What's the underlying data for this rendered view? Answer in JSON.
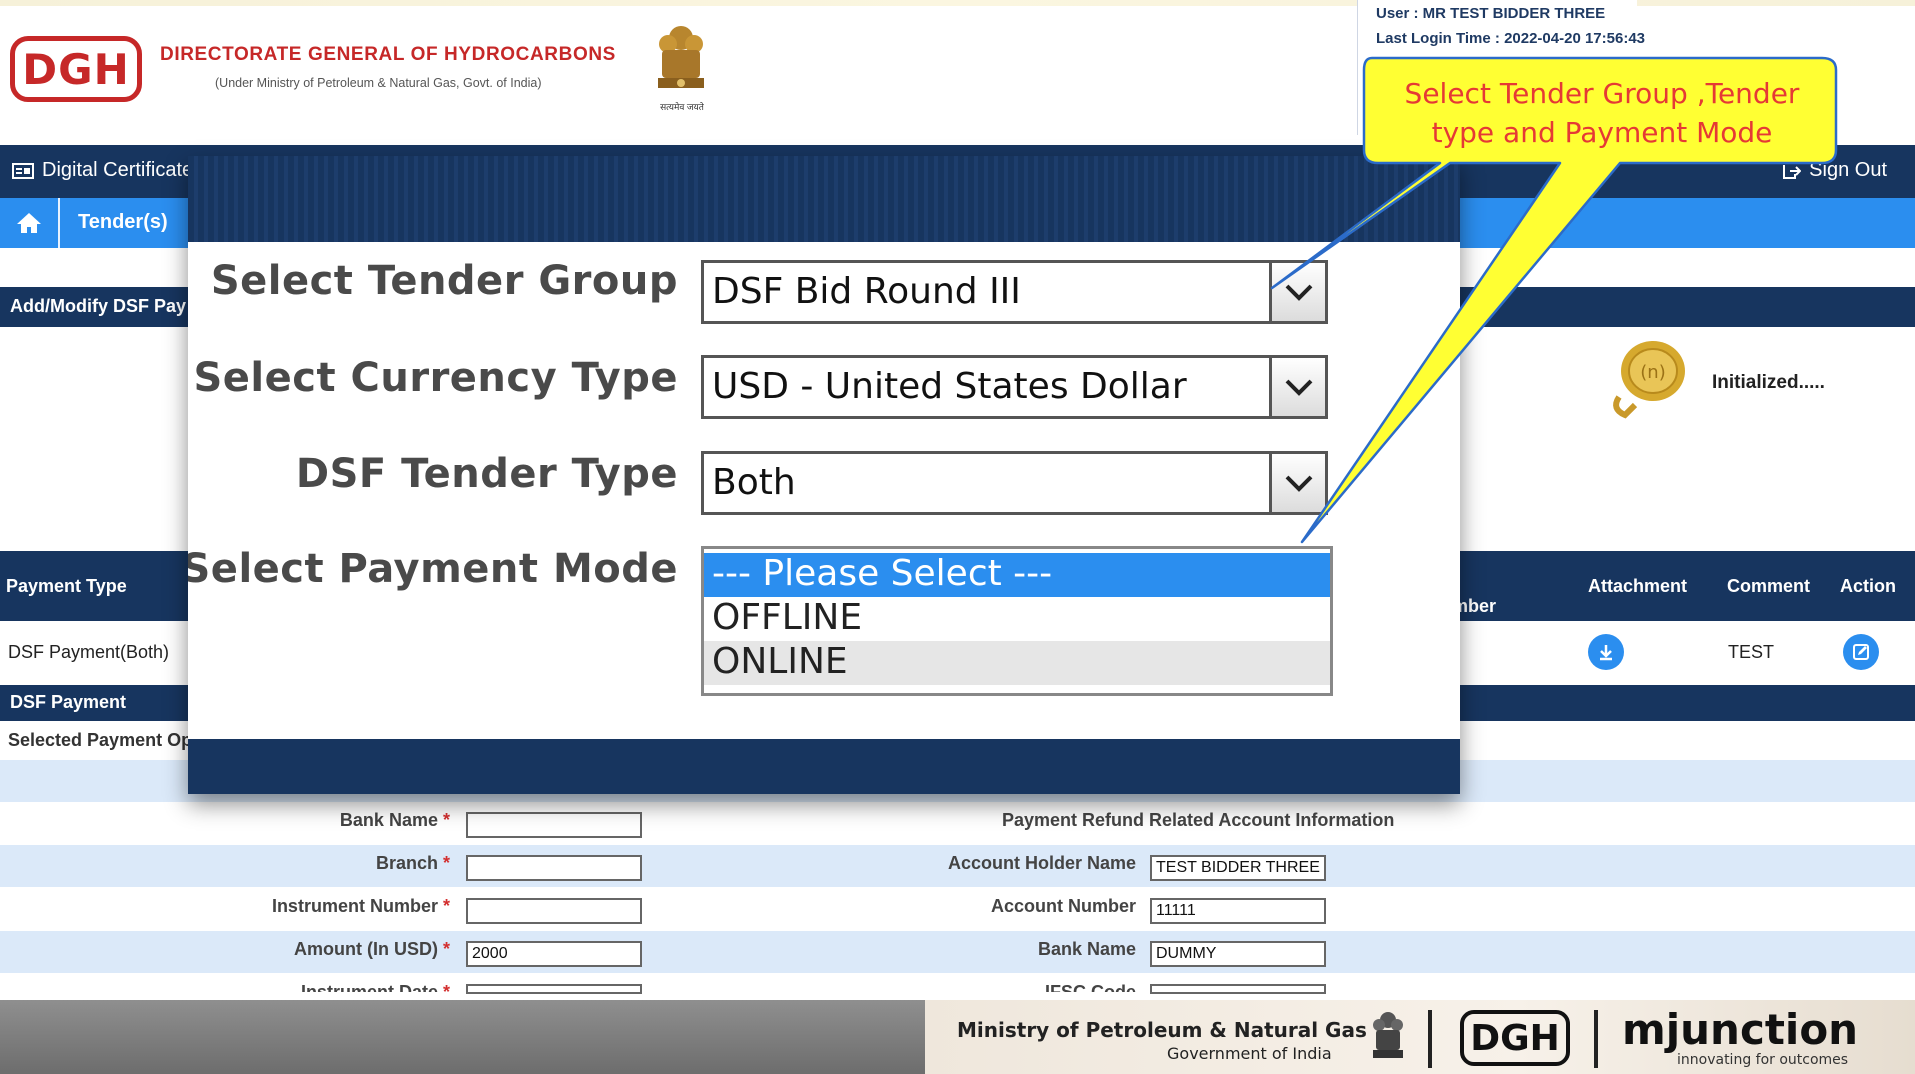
{
  "header": {
    "logo_text": "DGH",
    "org_title": "DIRECTORATE GENERAL OF HYDROCARBONS",
    "org_subtitle": "(Under Ministry of Petroleum & Natural Gas, Govt. of India)",
    "emblem_caption": "सत्यमेव जयते",
    "user_line": "User :  MR TEST BIDDER THREE",
    "login_line": "Last Login Time : 2022-04-20 17:56:43"
  },
  "nav": {
    "digital_certificate": "Digital Certificate",
    "sign_out": "Sign Out",
    "tenders": "Tender(s)"
  },
  "page": {
    "section_title": "Add/Modify DSF Pay",
    "status": "Initialized.....",
    "table": {
      "col_payment_type": "Payment Type",
      "col_number": "mber",
      "col_attachment": "Attachment",
      "col_comment": "Comment",
      "col_action": "Action",
      "row_payment_type": "DSF Payment(Both)",
      "row_comment": "TEST"
    },
    "dsf_payment_title": "DSF Payment",
    "selected_payment": "Selected Payment Op",
    "form": {
      "bank_name_label": "Bank Name",
      "branch_label": "Branch",
      "instrument_number_label": "Instrument Number",
      "amount_label": "Amount (In USD)",
      "instrument_date_label": "Instrument Date",
      "required_mark": "*",
      "amount_value": "2000",
      "refund_heading": "Payment Refund Related Account Information",
      "holder_label": "Account Holder Name",
      "holder_value": "TEST BIDDER THREE",
      "account_label": "Account Number",
      "account_value": "11111",
      "refund_bank_label": "Bank Name",
      "refund_bank_value": "DUMMY",
      "ifsc_label": "IFSC Code"
    }
  },
  "zoom": {
    "tender_group_label": "Select Tender Group",
    "tender_group_value": "DSF Bid Round III",
    "currency_label": "Select Currency Type",
    "currency_value": "USD - United States Dollar",
    "tender_type_label": "DSF Tender Type",
    "tender_type_value": "Both",
    "payment_mode_label": "Select Payment Mode",
    "payment_mode_options": [
      "--- Please Select ---",
      "OFFLINE",
      "ONLINE"
    ]
  },
  "callout": {
    "line1": "Select Tender Group ,Tender",
    "line2": "type and Payment Mode"
  },
  "footer": {
    "ministry": "Ministry of Petroleum & Natural Gas",
    "government": "Government of India",
    "dgh": "DGH",
    "mjunction": "mjunction",
    "mjunction_tagline": "innovating for outcomes"
  },
  "colors": {
    "navy": "#17355f",
    "blue": "#2b8eef",
    "callout_fill": "#ffff33",
    "callout_text": "#e53935",
    "dgh_red": "#c62828"
  }
}
